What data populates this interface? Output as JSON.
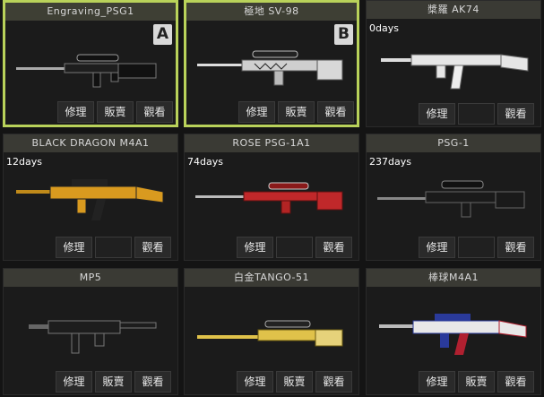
{
  "buttons": {
    "repair": "修理",
    "sell": "販賣",
    "view": "觀看"
  },
  "colors": {
    "selected_border": "#b9d25a",
    "title_bar": "#3a3a34"
  },
  "cards": [
    {
      "name": "Engraving_PSG1",
      "days": "",
      "badge": "A",
      "selected": true,
      "sell": true
    },
    {
      "name": "極地 SV-98",
      "days": "",
      "badge": "B",
      "selected": true,
      "sell": true
    },
    {
      "name": "槳羅 AK74",
      "days": "0days",
      "badge": "",
      "selected": false,
      "sell": false
    },
    {
      "name": "BLACK DRAGON M4A1",
      "days": "12days",
      "badge": "",
      "selected": false,
      "sell": false
    },
    {
      "name": "ROSE PSG-1A1",
      "days": "74days",
      "badge": "",
      "selected": false,
      "sell": false
    },
    {
      "name": "PSG-1",
      "days": "237days",
      "badge": "",
      "selected": false,
      "sell": false
    },
    {
      "name": "MP5",
      "days": "",
      "badge": "",
      "selected": false,
      "sell": true
    },
    {
      "name": "白金TANGO-51",
      "days": "",
      "badge": "",
      "selected": false,
      "sell": true
    },
    {
      "name": "棒球M4A1",
      "days": "",
      "badge": "",
      "selected": false,
      "sell": true
    }
  ]
}
